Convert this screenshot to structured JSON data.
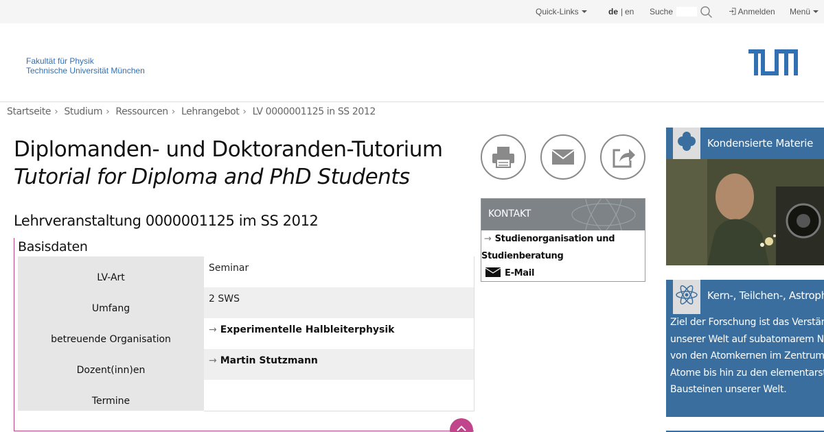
{
  "topbar": {
    "quicklinks": "Quick-Links",
    "lang_de": "de",
    "lang_sep": "|",
    "lang_en": "en",
    "search_label": "Suche",
    "login": "Anmelden",
    "menu": "Menü"
  },
  "header": {
    "faculty": "Fakultät für Physik",
    "university": "Technische Universität München",
    "logo_alt": "TUM"
  },
  "breadcrumb": [
    "Startseite",
    "Studium",
    "Ressourcen",
    "Lehrangebot",
    "LV 0000001125 in SS 2012"
  ],
  "page": {
    "title_de": "Diplomanden- und Doktoranden-Tutorium",
    "title_en": "Tutorial for Diploma and PhD Students",
    "subtitle": "Lehrveranstaltung 0000001125 im SS 2012"
  },
  "basisdaten": {
    "heading": "Basisdaten",
    "rows": [
      {
        "label": "LV-Art",
        "value": "Seminar"
      },
      {
        "label": "Umfang",
        "value": "2 SWS"
      },
      {
        "label": "betreuende Organisation",
        "value": "Experimentelle Halbleiterphysik"
      },
      {
        "label": "Dozent(inn)en",
        "value": "Martin Stutzmann"
      },
      {
        "label": "Termine",
        "value": ""
      }
    ]
  },
  "kontakt": {
    "heading": "KONTAKT",
    "link1_line1": "Studienorganisation und",
    "link1_line2": "Studienberatung",
    "email": "E-Mail"
  },
  "cards": [
    {
      "title": "Kondensierte Materie"
    },
    {
      "title": "Kern-, Teilchen-, Astrophysik",
      "text": [
        "Ziel der Forschung ist das Verständnis",
        "unserer Welt auf subatomarem Niveau,",
        "von den Atomkernen im Zentrum der",
        "Atome bis hin zu den elementarsten",
        "Bausteinen unserer Welt."
      ]
    }
  ],
  "colors": {
    "accent_blue": "#3070b3",
    "card_blue": "#3a6e9e",
    "magenta": "#c0458a",
    "kontakt_gray": "#7d8387"
  }
}
